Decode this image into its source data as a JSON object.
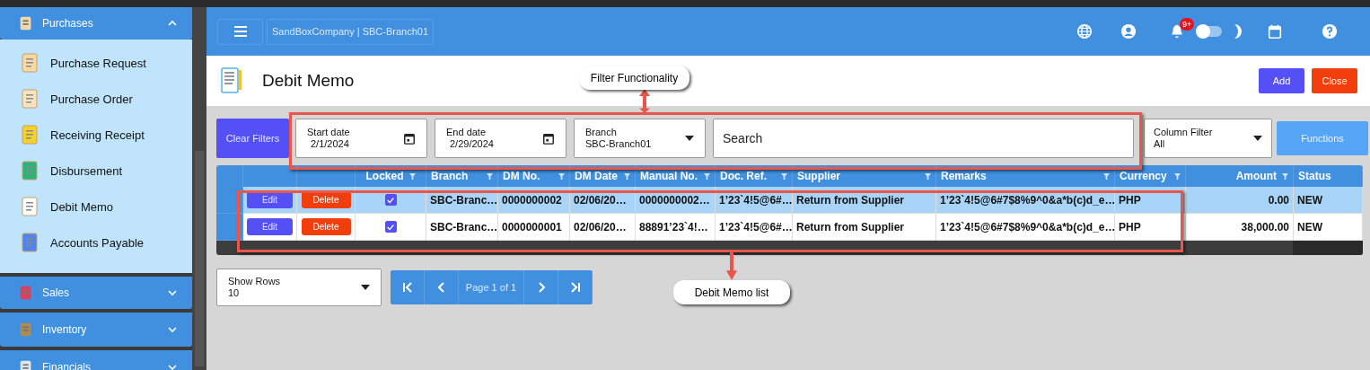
{
  "sidebar": {
    "groups": [
      {
        "label": "Purchases",
        "expanded": true,
        "items": [
          {
            "label": "Purchase Request"
          },
          {
            "label": "Purchase Order"
          },
          {
            "label": "Receiving Receipt"
          },
          {
            "label": "Disbursement"
          },
          {
            "label": "Debit Memo"
          },
          {
            "label": "Accounts Payable"
          }
        ]
      },
      {
        "label": "Sales",
        "expanded": false
      },
      {
        "label": "Inventory",
        "expanded": false
      },
      {
        "label": "Financials",
        "expanded": false
      }
    ]
  },
  "header": {
    "company": "SandBoxCompany | SBC-Branch01",
    "notification_badge": "9+",
    "dark_mode": {
      "on": false
    }
  },
  "page": {
    "title": "Debit Memo",
    "buttons": [
      {
        "label": "Add",
        "kind": "primary"
      },
      {
        "label": "Close",
        "kind": "danger"
      }
    ]
  },
  "filters": {
    "clear_button": "Clear Filters",
    "start_date": {
      "label": "Start date",
      "value": "2/1/2024"
    },
    "end_date": {
      "label": "End date",
      "value": "2/29/2024"
    },
    "branch": {
      "label": "Branch",
      "value": "SBC-Branch01"
    },
    "search": {
      "placeholder": "Search"
    },
    "column_filter": {
      "label": "Column Filter",
      "value": "All"
    },
    "functions_button": "Functions"
  },
  "table": {
    "locked_column": {
      "label": "Locked",
      "filter": true
    },
    "columns": [
      {
        "label": "Branch",
        "filter": true
      },
      {
        "label": "DM No.",
        "filter": true
      },
      {
        "label": "DM Date",
        "filter": true
      },
      {
        "label": "Manual No.",
        "filter": true
      },
      {
        "label": "Doc. Ref.",
        "filter": true
      },
      {
        "label": "Supplier",
        "filter": true
      },
      {
        "label": "Remarks",
        "filter": true
      },
      {
        "label": "Currency",
        "filter": true
      },
      {
        "label": "Amount",
        "filter": true
      },
      {
        "label": "Status",
        "filter": false
      }
    ],
    "rows": [
      {
        "selected": true,
        "edit": "Edit",
        "delete": "Delete",
        "locked": true,
        "cells": [
          "SBC-Branc…",
          "0000000002",
          "02/06/20…",
          "0000000002…",
          "1’23`4!5@6#…",
          "Return from Supplier",
          "1’23`4!5@6#7$8%9^0&a*b(c)d_e…",
          "PHP",
          "0.00",
          "NEW"
        ]
      },
      {
        "selected": false,
        "edit": "Edit",
        "delete": "Delete",
        "locked": true,
        "cells": [
          "SBC-Branc…",
          "0000000001",
          "02/06/20…",
          "88891’23`4!…",
          "1’23`4!5@6#…",
          "Return from Supplier",
          "1’23`4!5@6#7$8%9^0&a*b(c)d_e…",
          "PHP",
          "38,000.00",
          "NEW"
        ]
      }
    ]
  },
  "pagination": {
    "show_rows": {
      "label": "Show Rows",
      "value": "10"
    },
    "page_label": "Page 1 of 1"
  },
  "annotations": [
    {
      "text": "Filter Functionality"
    },
    {
      "text": "Debit Memo list"
    }
  ]
}
